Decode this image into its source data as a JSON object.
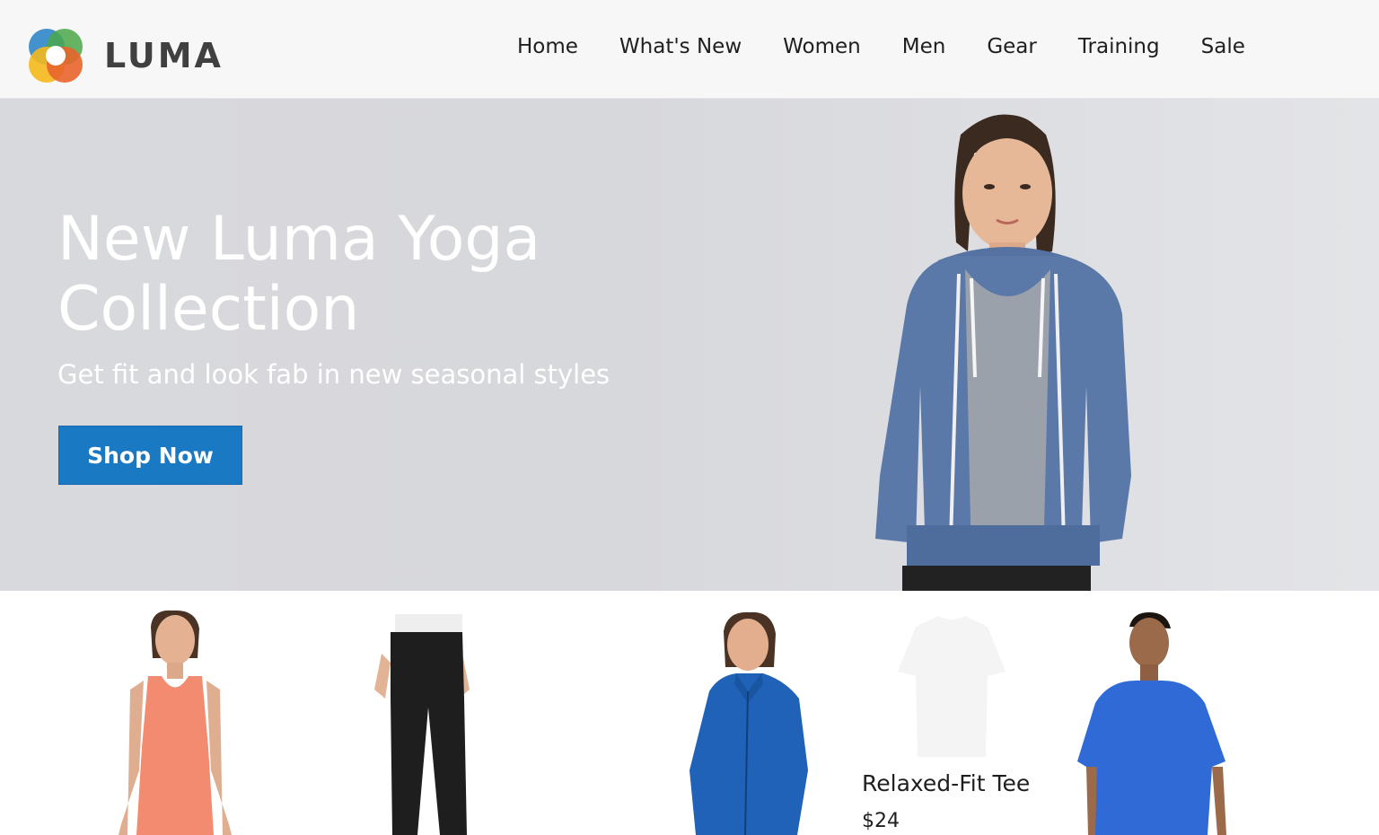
{
  "header": {
    "logo_text": "LUMA",
    "nav": [
      "Home",
      "What's New",
      "Women",
      "Men",
      "Gear",
      "Training",
      "Sale"
    ]
  },
  "hero": {
    "title": "New Luma Yoga Collection",
    "subtitle": "Get fit and look fab in new seasonal styles",
    "cta_label": "Shop Now"
  },
  "products": [
    {
      "icon": "coral-tank-top-photo"
    },
    {
      "icon": "black-yoga-pants-photo"
    },
    {
      "icon": "blue-zip-jacket-photo"
    },
    {
      "icon": "white-tee-photo",
      "name": "Relaxed-Fit Tee",
      "price": "$24"
    },
    {
      "icon": "blue-mens-tee-photo"
    }
  ],
  "colors": {
    "accent": "#1979c3",
    "header_bg": "#f7f7f7",
    "hero_bg": "#d8d9dc"
  }
}
